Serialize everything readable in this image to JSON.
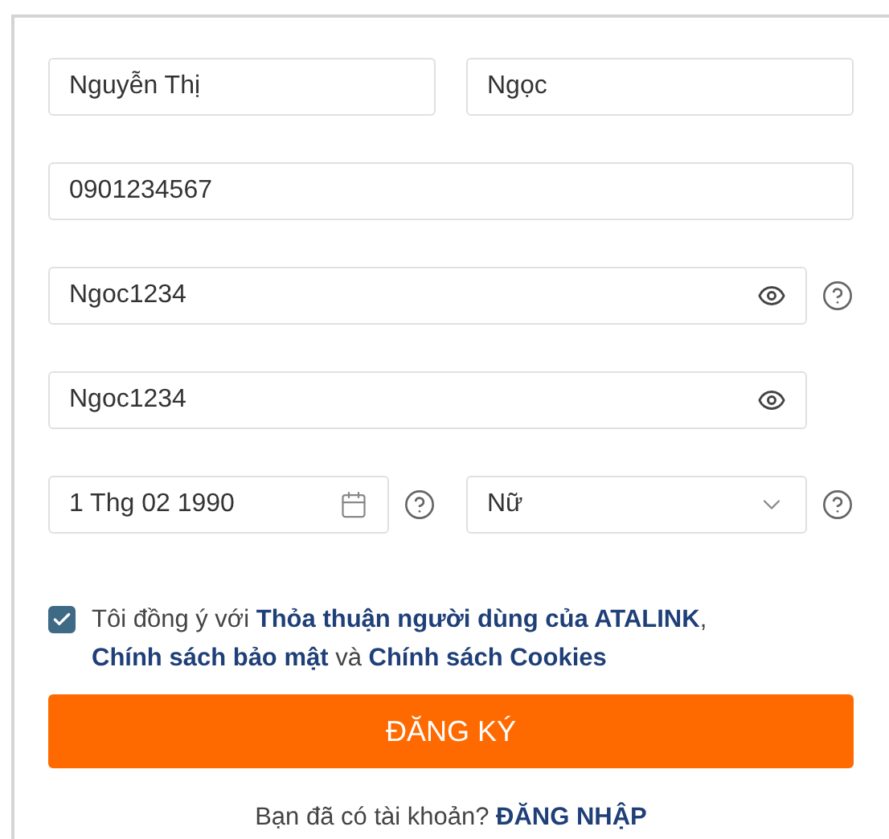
{
  "rows": [
    {
      "fields": [
        {
          "kind": "text",
          "value": "Nguyễn Thị",
          "help": false
        },
        {
          "kind": "text",
          "value": "Ngọc",
          "help": false
        }
      ]
    },
    {
      "fields": [
        {
          "kind": "text",
          "value": "0901234567",
          "help": false
        }
      ]
    },
    {
      "fields": [
        {
          "kind": "password",
          "value": "Ngoc1234",
          "help": true
        }
      ]
    },
    {
      "fields": [
        {
          "kind": "password",
          "value": "Ngoc1234",
          "help": false
        }
      ]
    },
    {
      "fields": [
        {
          "kind": "date",
          "value": "1 Thg 02 1990",
          "help": true
        },
        {
          "kind": "select",
          "value": "Nữ",
          "help": true
        }
      ]
    }
  ],
  "agreement": {
    "checked": true,
    "parts": [
      {
        "kind": "text",
        "text": "Tôi đồng ý với "
      },
      {
        "kind": "link",
        "text": "Thỏa thuận người dùng của ATALINK"
      },
      {
        "kind": "text",
        "text": ", "
      },
      {
        "kind": "link",
        "text": "Chính sách bảo mật"
      },
      {
        "kind": "text",
        "text": " và "
      },
      {
        "kind": "link",
        "text": "Chính sách Cookies"
      }
    ]
  },
  "submit": "ĐĂNG KÝ",
  "login": {
    "prompt": "Bạn đã có tài khoản?",
    "link": "ĐĂNG NHẬP"
  }
}
